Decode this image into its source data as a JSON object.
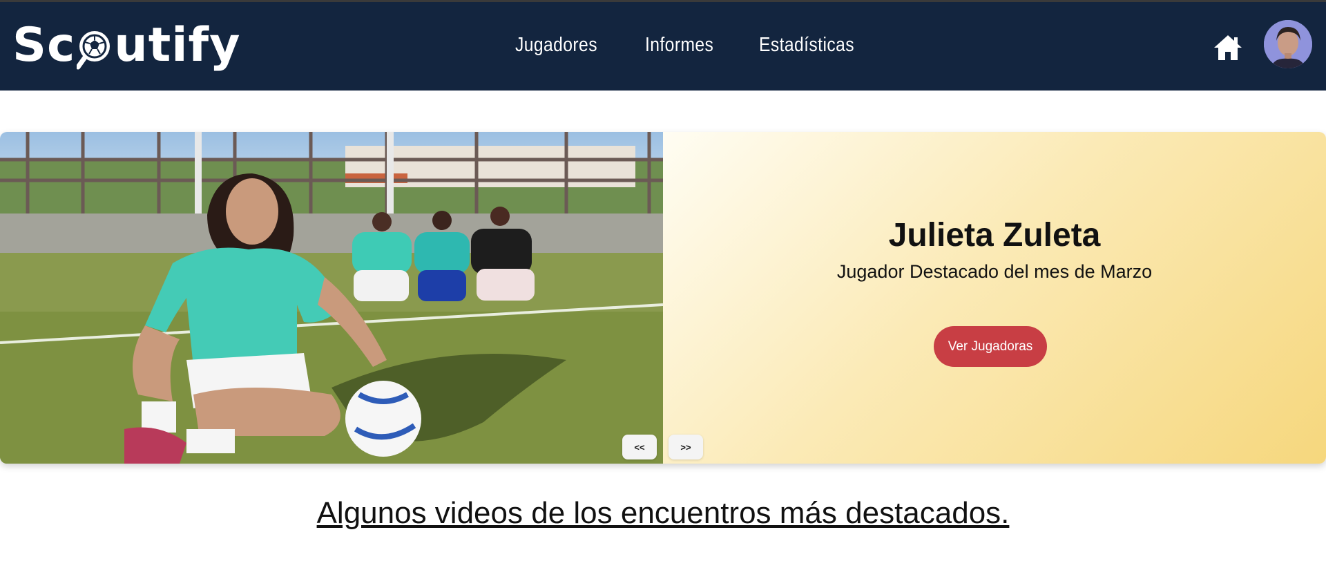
{
  "app": {
    "logo_text_left": "Sc",
    "logo_text_right": "utify",
    "brand_color": "#13253f"
  },
  "nav": {
    "items": [
      {
        "label": "Jugadores"
      },
      {
        "label": "Informes"
      },
      {
        "label": "Estadísticas"
      }
    ]
  },
  "icons": {
    "home": "home-icon",
    "avatar": "user-avatar"
  },
  "hero": {
    "player_name": "Julieta Zuleta",
    "subtitle": "Jugador Destacado del mes de Marzo",
    "cta_label": "Ver Jugadoras",
    "cta_color": "#c83e44",
    "prev_label": "<<",
    "next_label": ">>"
  },
  "section": {
    "title": "Algunos videos de los encuentros más destacados."
  }
}
